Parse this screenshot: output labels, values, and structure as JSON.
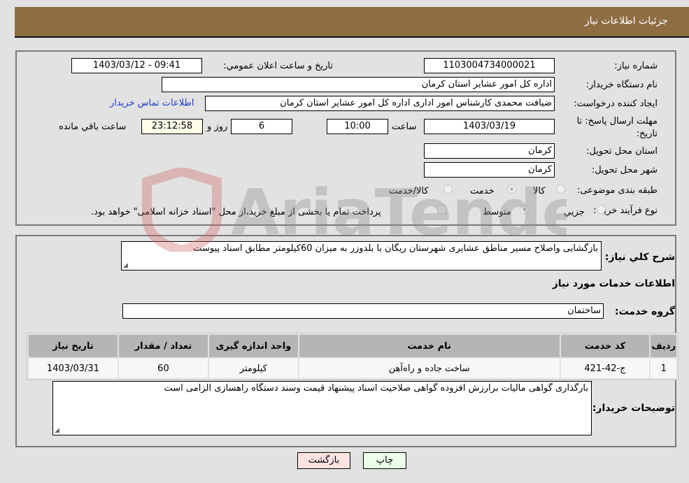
{
  "header": {
    "title": "جزئیات اطلاعات نیاز"
  },
  "details": {
    "need_number": {
      "label": "شماره نیاز:",
      "value": "1103004734000021"
    },
    "announce_datetime": {
      "label": "تاریخ و ساعت اعلان عمومي:",
      "value": "1403/03/12 - 09:41"
    },
    "buyer_org": {
      "label": "نام دستگاه خريدار:",
      "value": "اداره کل امور عشایر استان کرمان"
    },
    "requester": {
      "label": "ايجاد کننده درخواست:",
      "value": "ضیافت محمدی کارشناس امور اداری اداره کل امور عشایر استان کرمان"
    },
    "buyer_contact_link": "اطلاعات تماس خريدار",
    "deadline": {
      "label": "مهلت ارسال پاسخ: تا تاریخ:",
      "date": "1403/03/19",
      "time_label": "ساعت",
      "time": "10:00",
      "days": "6",
      "days_label": "روز و",
      "remaining": "23:12:58",
      "remaining_label": "ساعت باقي مانده"
    },
    "delivery_province": {
      "label": "استان محل تحويل:",
      "value": "کرمان"
    },
    "delivery_city": {
      "label": "شهر محل تحويل:",
      "value": "کرمان"
    },
    "category": {
      "label": "طبقه بندی موضوعی:",
      "options": [
        "کالا",
        "خدمت",
        "کالا/خدمت"
      ],
      "selected": "خدمت"
    },
    "purchase_type": {
      "label": "نوع فرآيند خريد :",
      "options": [
        "جزيي",
        "متوسط"
      ],
      "selected": "متوسط",
      "treasury_note": "پرداخت تمام يا بخشی از مبلغ خريد،از محل \"اسناد خزانه اسلامی\" خواهد بود."
    }
  },
  "description": {
    "label": "شرح كلي نياز:",
    "value": "بازگشایی واصلاح مسیر مناطق عشایری شهرستان ریگان با بلدوزر به میزان 60کیلومتر مطابق اسناد پیوست"
  },
  "services": {
    "section_title": "اطلاعات خدمات مورد نياز",
    "group_label": "گروه خدمت:",
    "group_value": "ساختمان",
    "columns": [
      "رديف",
      "کد خدمت",
      "نام خدمت",
      "واحد اندازه گيری",
      "تعداد / مقدار",
      "تاريخ نياز"
    ],
    "rows": [
      {
        "row": "1",
        "code": "ج-42-421",
        "name": "ساخت جاده و راه‌آهن",
        "unit": "کیلومتر",
        "qty": "60",
        "date": "1403/03/31"
      }
    ]
  },
  "buyer_notes": {
    "label": "توضيحات خريدار:",
    "value": "بارگذاری گواهی مالیات برارزش افزوده گواهی صلاحیت اسناد پیشنهاد قیمت وسند دستگاه راهسازی الزامی است"
  },
  "buttons": {
    "print": "چاپ",
    "back": "بازگشت"
  },
  "watermark": "AriaTender.neT"
}
